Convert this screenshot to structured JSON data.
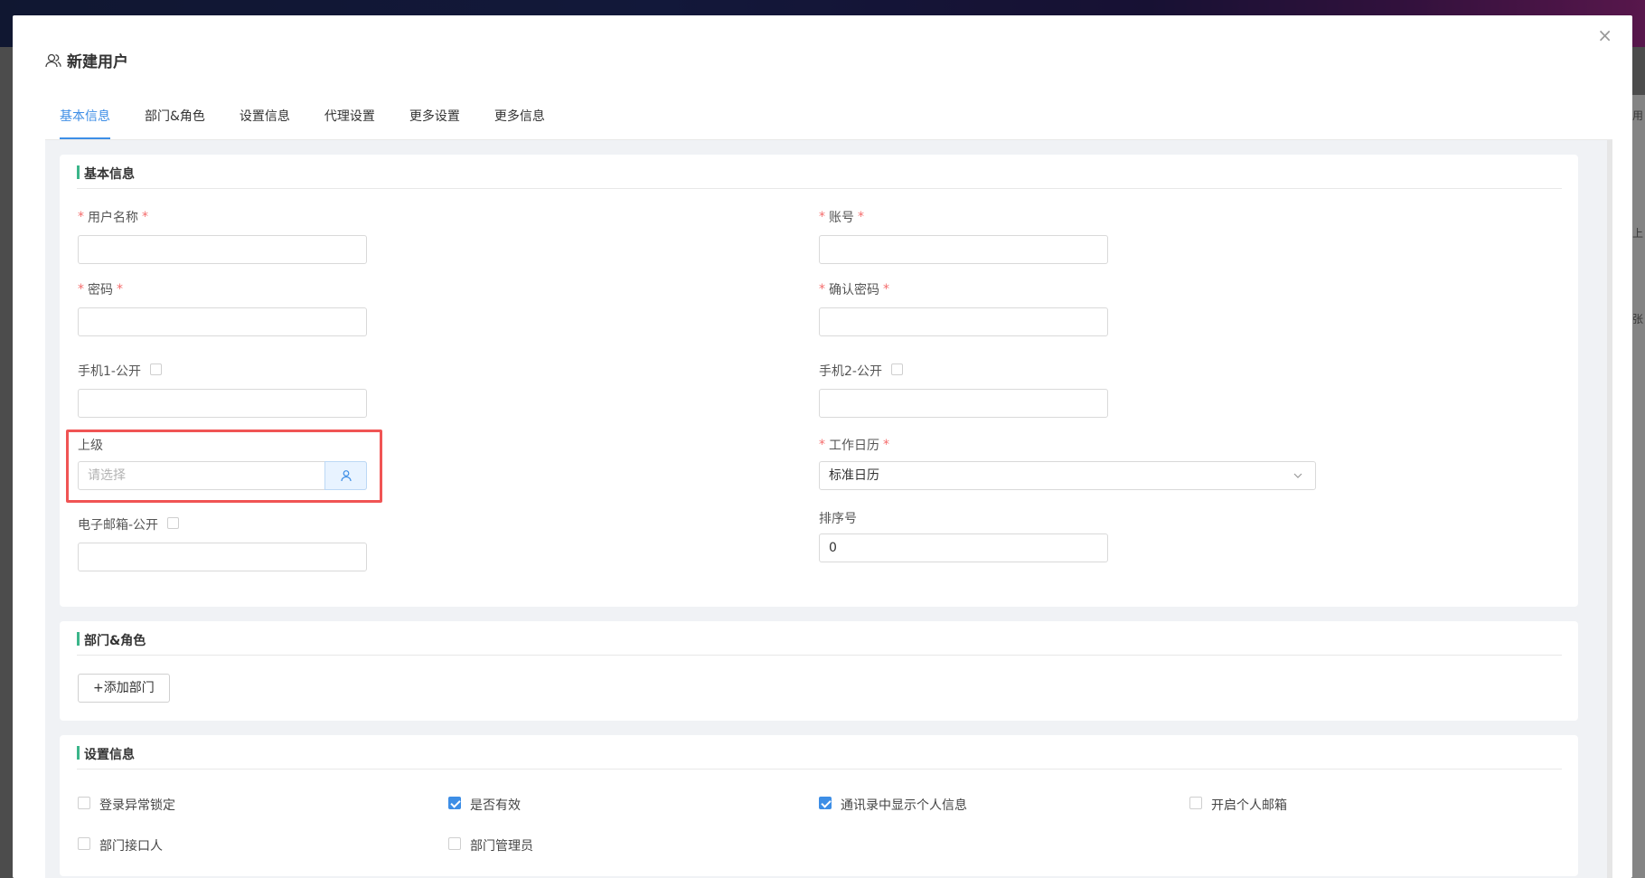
{
  "modal": {
    "title": "新建用户",
    "close_glyph": "×"
  },
  "tabs": [
    {
      "label": "基本信息",
      "active": true
    },
    {
      "label": "部门&角色",
      "active": false
    },
    {
      "label": "设置信息",
      "active": false
    },
    {
      "label": "代理设置",
      "active": false
    },
    {
      "label": "更多设置",
      "active": false
    },
    {
      "label": "更多信息",
      "active": false
    }
  ],
  "basic": {
    "heading": "基本信息",
    "required_mark": "*",
    "username": {
      "label": "用户名称",
      "value": ""
    },
    "account": {
      "label": "账号",
      "value": ""
    },
    "password": {
      "label": "密码",
      "value": ""
    },
    "confirm_password": {
      "label": "确认密码",
      "value": ""
    },
    "phone1": {
      "label": "手机1-公开",
      "value": ""
    },
    "phone2": {
      "label": "手机2-公开",
      "value": ""
    },
    "superior": {
      "label": "上级",
      "placeholder": "请选择"
    },
    "work_calendar": {
      "label": "工作日历",
      "value": "标准日历"
    },
    "email": {
      "label": "电子邮箱-公开",
      "value": ""
    },
    "sort_no": {
      "label": "排序号",
      "value": "0"
    }
  },
  "dept": {
    "heading": "部门&角色",
    "add_button": "+添加部门"
  },
  "settings": {
    "heading": "设置信息",
    "options": [
      {
        "label": "登录异常锁定",
        "checked": false
      },
      {
        "label": "是否有效",
        "checked": true
      },
      {
        "label": "通讯录中显示个人信息",
        "checked": true
      },
      {
        "label": "开启个人邮箱",
        "checked": false
      },
      {
        "label": "部门接口人",
        "checked": false
      },
      {
        "label": "部门管理员",
        "checked": false
      }
    ]
  },
  "background_peek": [
    "用",
    "上",
    "张"
  ],
  "colors": {
    "accent": "#3d8ee6",
    "section_bar": "#3bb58a",
    "required": "#f56c6c",
    "highlight": "#f05454"
  }
}
